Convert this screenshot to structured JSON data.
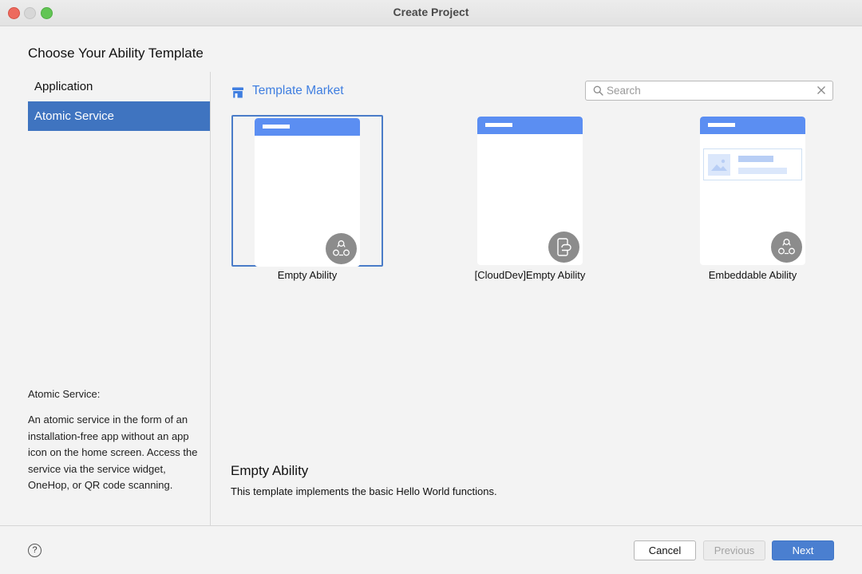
{
  "window": {
    "title": "Create Project"
  },
  "heading": "Choose Your Ability Template",
  "nav": {
    "items": [
      {
        "label": "Application"
      },
      {
        "label": "Atomic Service"
      }
    ],
    "selected": "Atomic Service"
  },
  "help": {
    "title": "Atomic Service:",
    "text": "An atomic service in the form of an installation-free app without an app icon on the home screen. Access the service via the service widget, OneHop, or QR code scanning."
  },
  "market": {
    "label": "Template Market"
  },
  "search": {
    "placeholder": "Search",
    "value": ""
  },
  "templates": [
    {
      "label": "Empty Ability",
      "icon": "atomic-service-icon",
      "selected": true
    },
    {
      "label": "[CloudDev]Empty Ability",
      "icon": "cloud-dev-icon",
      "selected": false
    },
    {
      "label": "Embeddable Ability",
      "icon": "atomic-service-icon",
      "selected": false
    }
  ],
  "description": {
    "title": "Empty Ability",
    "text": "This template implements the basic Hello World functions."
  },
  "footer": {
    "help_label": "?",
    "cancel_label": "Cancel",
    "previous_label": "Previous",
    "next_label": "Next"
  },
  "colors": {
    "accent": "#3f74c0",
    "link": "#3f7ee0",
    "template_bar": "#5b8ef2",
    "badge": "#8c8c8c"
  }
}
